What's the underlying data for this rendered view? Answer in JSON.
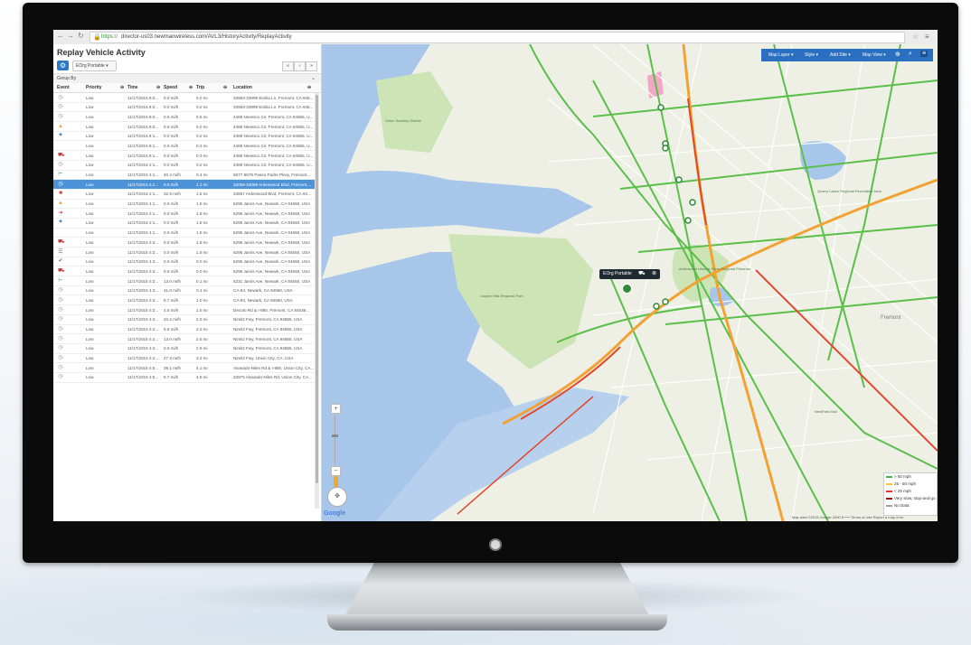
{
  "browser": {
    "url_scheme": "https://",
    "url_rest": "director-us03.newmanwireless.com/AVL3/HistoryActivity/ReplayActivity"
  },
  "panel": {
    "title": "Replay Vehicle Activity",
    "vehicle_select": "EOrg Portable",
    "group_label": "Group By"
  },
  "table": {
    "columns": [
      "Event",
      "Priority",
      "Time",
      "Speed",
      "Trip",
      "Location"
    ],
    "rows": [
      {
        "icon": "clock-icon",
        "priority": "Low",
        "time": "11/17/2015 8:0...",
        "speed": "0.0 mi/h",
        "trip": "0.2 mi",
        "location": "33963-33999 Emilia Ln, Fremont, CA 945..."
      },
      {
        "icon": "clock-icon",
        "priority": "Low",
        "time": "11/17/2015 8:0...",
        "speed": "0.0 mi/h",
        "trip": "0.2 mi",
        "location": "33963-33999 Emilia Ln, Fremont, CA 945..."
      },
      {
        "icon": "clock-icon",
        "priority": "Low",
        "time": "11/17/2015 8:0...",
        "speed": "0.6 mi/h",
        "trip": "0.6 mi",
        "location": "4488 Nevesco Cir, Fremont, CA 94555, U..."
      },
      {
        "icon": "warning-icon",
        "priority": "Low",
        "time": "11/17/2015 8:0...",
        "speed": "0.6 mi/h",
        "trip": "0.2 mi",
        "location": "4488 Nevesco Cir, Fremont, CA 94555, U..."
      },
      {
        "icon": "gear-icon",
        "priority": "Low",
        "time": "11/17/2015 8:1...",
        "speed": "0.0 mi/h",
        "trip": "0.2 mi",
        "location": "4488 Nevesco Cir, Fremont, CA 94555, U..."
      },
      {
        "icon": "none",
        "priority": "Low",
        "time": "11/17/2015 8:1...",
        "speed": "0.0 mi/h",
        "trip": "0.3 mi",
        "location": "4488 Nevesco Cir, Fremont, CA 94555, U..."
      },
      {
        "icon": "truck-icon",
        "priority": "Low",
        "time": "11/17/2015 8:1...",
        "speed": "0.0 mi/h",
        "trip": "0.3 mi",
        "location": "4488 Nevesco Cir, Fremont, CA 94555, U..."
      },
      {
        "icon": "clock-icon",
        "priority": "Low",
        "time": "11/17/2015 4:1...",
        "speed": "0.0 mi/h",
        "trip": "0.2 mi",
        "location": "4488 Nevesco Cir, Fremont, CA 94555, U..."
      },
      {
        "icon": "ignition-on-icon",
        "priority": "Low",
        "time": "11/17/2015 4:1...",
        "speed": "40.4 mi/h",
        "trip": "0.4 mi",
        "location": "5577-5679 Paseo Padre Pkwy, Fremont,..."
      },
      {
        "icon": "clock-icon",
        "priority": "Low",
        "time": "11/17/2015 4:1...",
        "speed": "0.0 mi/h",
        "trip": "1.1 mi",
        "location": "34059-34099 Ardenwood Blvd, Fremont,...",
        "selected": true
      },
      {
        "icon": "stop-icon",
        "priority": "Low",
        "time": "11/17/2015 4:1...",
        "speed": "32.9 mi/h",
        "trip": "1.6 mi",
        "location": "34867 Ardenwood Blvd, Fremont, CA 94..."
      },
      {
        "icon": "warning-icon",
        "priority": "Low",
        "time": "11/17/2015 4:1...",
        "speed": "0.0 mi/h",
        "trip": "1.8 mi",
        "location": "6295 Jarvis Ave, Newark, CA 94560, USA"
      },
      {
        "icon": "arrow-right-icon",
        "priority": "Low",
        "time": "11/17/2015 4:1...",
        "speed": "0.0 mi/h",
        "trip": "1.8 mi",
        "location": "6295 Jarvis Ave, Newark, CA 94560, USA"
      },
      {
        "icon": "gear-icon",
        "priority": "Low",
        "time": "11/17/2015 4:1...",
        "speed": "0.0 mi/h",
        "trip": "1.8 mi",
        "location": "6295 Jarvis Ave, Newark, CA 94560, USA"
      },
      {
        "icon": "none",
        "priority": "Low",
        "time": "11/17/2015 4:1...",
        "speed": "0.0 mi/h",
        "trip": "1.8 mi",
        "location": "6295 Jarvis Ave, Newark, CA 94560, USA"
      },
      {
        "icon": "truck-icon",
        "priority": "Low",
        "time": "11/17/2015 4:3...",
        "speed": "0.0 mi/h",
        "trip": "1.8 mi",
        "location": "6295 Jarvis Ave, Newark, CA 94560, USA"
      },
      {
        "icon": "list-icon",
        "priority": "Low",
        "time": "11/17/2015 4:3...",
        "speed": "0.0 mi/h",
        "trip": "1.8 mi",
        "location": "6295 Jarvis Ave, Newark, CA 94560, USA"
      },
      {
        "icon": "green-check-icon",
        "priority": "Low",
        "time": "11/17/2015 4:3...",
        "speed": "0.0 mi/h",
        "trip": "0.0 mi",
        "location": "6295 Jarvis Ave, Newark, CA 94560, USA"
      },
      {
        "icon": "truck-icon",
        "priority": "Low",
        "time": "11/17/2015 4:3...",
        "speed": "0.6 mi/h",
        "trip": "0.0 mi",
        "location": "6295 Jarvis Ave, Newark, CA 94560, USA"
      },
      {
        "icon": "ignition-on-icon",
        "priority": "Low",
        "time": "11/17/2015 4:3...",
        "speed": "13.0 mi/h",
        "trip": "0.1 mi",
        "location": "6231 Jarvis Ave, Newark, CA 94560, USA"
      },
      {
        "icon": "clock-icon",
        "priority": "Low",
        "time": "11/17/2015 4:3...",
        "speed": "41.0 mi/h",
        "trip": "0.4 mi",
        "location": "CA-84, Newark, CA 94560, USA"
      },
      {
        "icon": "clock-icon",
        "priority": "Low",
        "time": "11/17/2015 4:3...",
        "speed": "8.7 mi/h",
        "trip": "1.0 mi",
        "location": "CA-84, Newark, CA 94560, USA"
      },
      {
        "icon": "clock-icon",
        "priority": "Low",
        "time": "11/17/2015 4:3...",
        "speed": "4.5 mi/h",
        "trip": "1.5 mi",
        "location": "Decoto Rd & I-880, Fremont, CA 94536..."
      },
      {
        "icon": "clock-icon",
        "priority": "Low",
        "time": "11/17/2015 4:4...",
        "speed": "34.2 mi/h",
        "trip": "2.0 mi",
        "location": "Nimitz Fwy, Fremont, CA 94555, USA"
      },
      {
        "icon": "clock-icon",
        "priority": "Low",
        "time": "11/17/2015 4:4...",
        "speed": "6.8 mi/h",
        "trip": "2.2 mi",
        "location": "Nimitz Fwy, Fremont, CA 94555, USA"
      },
      {
        "icon": "clock-icon",
        "priority": "Low",
        "time": "11/17/2015 4:4...",
        "speed": "13.0 mi/h",
        "trip": "2.5 mi",
        "location": "Nimitz Fwy, Fremont, CA 94555, USA"
      },
      {
        "icon": "clock-icon",
        "priority": "Low",
        "time": "11/17/2015 4:4...",
        "speed": "0.0 mi/h",
        "trip": "2.9 mi",
        "location": "Nimitz Fwy, Fremont, CA 94555, USA"
      },
      {
        "icon": "clock-icon",
        "priority": "Low",
        "time": "11/17/2015 4:4...",
        "speed": "27.3 mi/h",
        "trip": "3.2 mi",
        "location": "Nimitz Fwy, Union City, CA, USA"
      },
      {
        "icon": "clock-icon",
        "priority": "Low",
        "time": "11/17/2015 4:5...",
        "speed": "39.1 mi/h",
        "trip": "4.1 mi",
        "location": "Alvarado-Niles Rd & I-880, Union City, CA..."
      },
      {
        "icon": "clock-icon",
        "priority": "Low",
        "time": "11/17/2015 4:5...",
        "speed": "8.7 mi/h",
        "trip": "4.9 mi",
        "location": "32875 Alvarado-Niles Rd, Union City, CA..."
      }
    ]
  },
  "map": {
    "toolbar": {
      "layer": "Map Layer ▾",
      "style": "Style ▾",
      "add_site": "Add Site ▾",
      "map_view": "Map View ▾"
    },
    "vehicle_label": "EOrg Portable",
    "google": "Google",
    "attribution": "Map data ©2015 Google   2000 ft ⎯⎯⎯   Terms of Use   Report a map error",
    "legend": [
      {
        "label": "> 50 mph",
        "color": "#4caf50"
      },
      {
        "label": "25 - 50 mph",
        "color": "#f6c744"
      },
      {
        "label": "< 25 mph",
        "color": "#e53935"
      },
      {
        "label": "Very slow, stop-and-go",
        "color": "#8b1a1a"
      },
      {
        "label": "No Data",
        "color": "#9e9e9e"
      }
    ],
    "places": {
      "fremont": "Fremont",
      "coyote": "Coyote Hills Regional Park",
      "ardenwood": "Ardenwood Historic Farm Regional Preserve",
      "quarry": "Quarry Lakes Regional Recreation Area",
      "sanitary": "Union Sanitary District",
      "newpark": "NewPark Mall",
      "ds": "Don Edwards San Francisco Bay National Wildlife Refuge"
    },
    "colors": {
      "water": "#a7c6ea",
      "park": "#cde4b6",
      "land": "#eef0e6",
      "traffic_green": "#5bbf4a",
      "traffic_red": "#e04a2c",
      "traffic_orange": "#f2a233"
    }
  }
}
